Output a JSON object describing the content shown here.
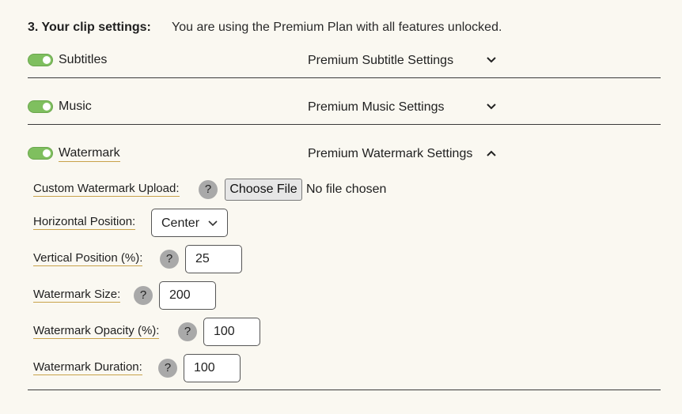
{
  "section": {
    "heading": "3. Your clip settings:",
    "plan_note": "You are using the Premium Plan with all features unlocked."
  },
  "features": [
    {
      "label": "Subtitles",
      "enabled": true,
      "settings_label": "Premium Subtitle Settings",
      "expanded": false
    },
    {
      "label": "Music",
      "enabled": true,
      "settings_label": "Premium Music Settings",
      "expanded": false
    },
    {
      "label": "Watermark",
      "enabled": true,
      "settings_label": "Premium Watermark Settings",
      "expanded": true
    }
  ],
  "watermark": {
    "upload": {
      "label": "Custom Watermark Upload:",
      "help": "?",
      "button": "Choose File",
      "status": "No file chosen"
    },
    "horizontal": {
      "label": "Horizontal Position:",
      "value": "Center"
    },
    "vertical": {
      "label": "Vertical Position (%):",
      "help": "?",
      "value": "25"
    },
    "size": {
      "label": "Watermark Size:",
      "help": "?",
      "value": "200"
    },
    "opacity": {
      "label": "Watermark Opacity (%):",
      "help": "?",
      "value": "100"
    },
    "duration": {
      "label": "Watermark Duration:",
      "help": "?",
      "value": "100"
    }
  },
  "colors": {
    "background": "#faf8f1",
    "toggle_on": "#7fbf5f",
    "label_underline": "#c8a24a",
    "help_badge": "#a9a9a9"
  }
}
